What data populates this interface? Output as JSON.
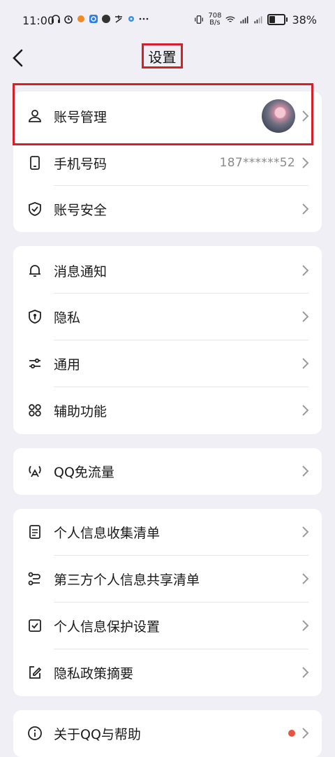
{
  "status_bar": {
    "time": "11:00",
    "net_speed_value": "708",
    "net_speed_unit": "B/s",
    "battery": "38%"
  },
  "header": {
    "title": "设置"
  },
  "groups": [
    {
      "rows": [
        {
          "label": "账号管理",
          "icon": "person-icon",
          "has_avatar": true
        },
        {
          "label": "手机号码",
          "icon": "phone-icon",
          "value": "187******52"
        },
        {
          "label": "账号安全",
          "icon": "shield-check-icon"
        }
      ]
    },
    {
      "rows": [
        {
          "label": "消息通知",
          "icon": "bell-icon"
        },
        {
          "label": "隐私",
          "icon": "privacy-shield-icon"
        },
        {
          "label": "通用",
          "icon": "sliders-icon"
        },
        {
          "label": "辅助功能",
          "icon": "grid-icon"
        }
      ]
    },
    {
      "rows": [
        {
          "label": "QQ免流量",
          "icon": "signal-tower-icon"
        }
      ]
    },
    {
      "rows": [
        {
          "label": "个人信息收集清单",
          "icon": "document-icon"
        },
        {
          "label": "第三方个人信息共享清单",
          "icon": "share-flow-icon"
        },
        {
          "label": "个人信息保护设置",
          "icon": "checkbox-doc-icon"
        },
        {
          "label": "隐私政策摘要",
          "icon": "edit-icon"
        }
      ]
    },
    {
      "rows": [
        {
          "label": "关于QQ与帮助",
          "icon": "info-icon",
          "has_dot": true
        }
      ]
    }
  ],
  "colors": {
    "highlight": "#d61f2a",
    "dot": "#e8553e",
    "background": "#f0eff5"
  }
}
